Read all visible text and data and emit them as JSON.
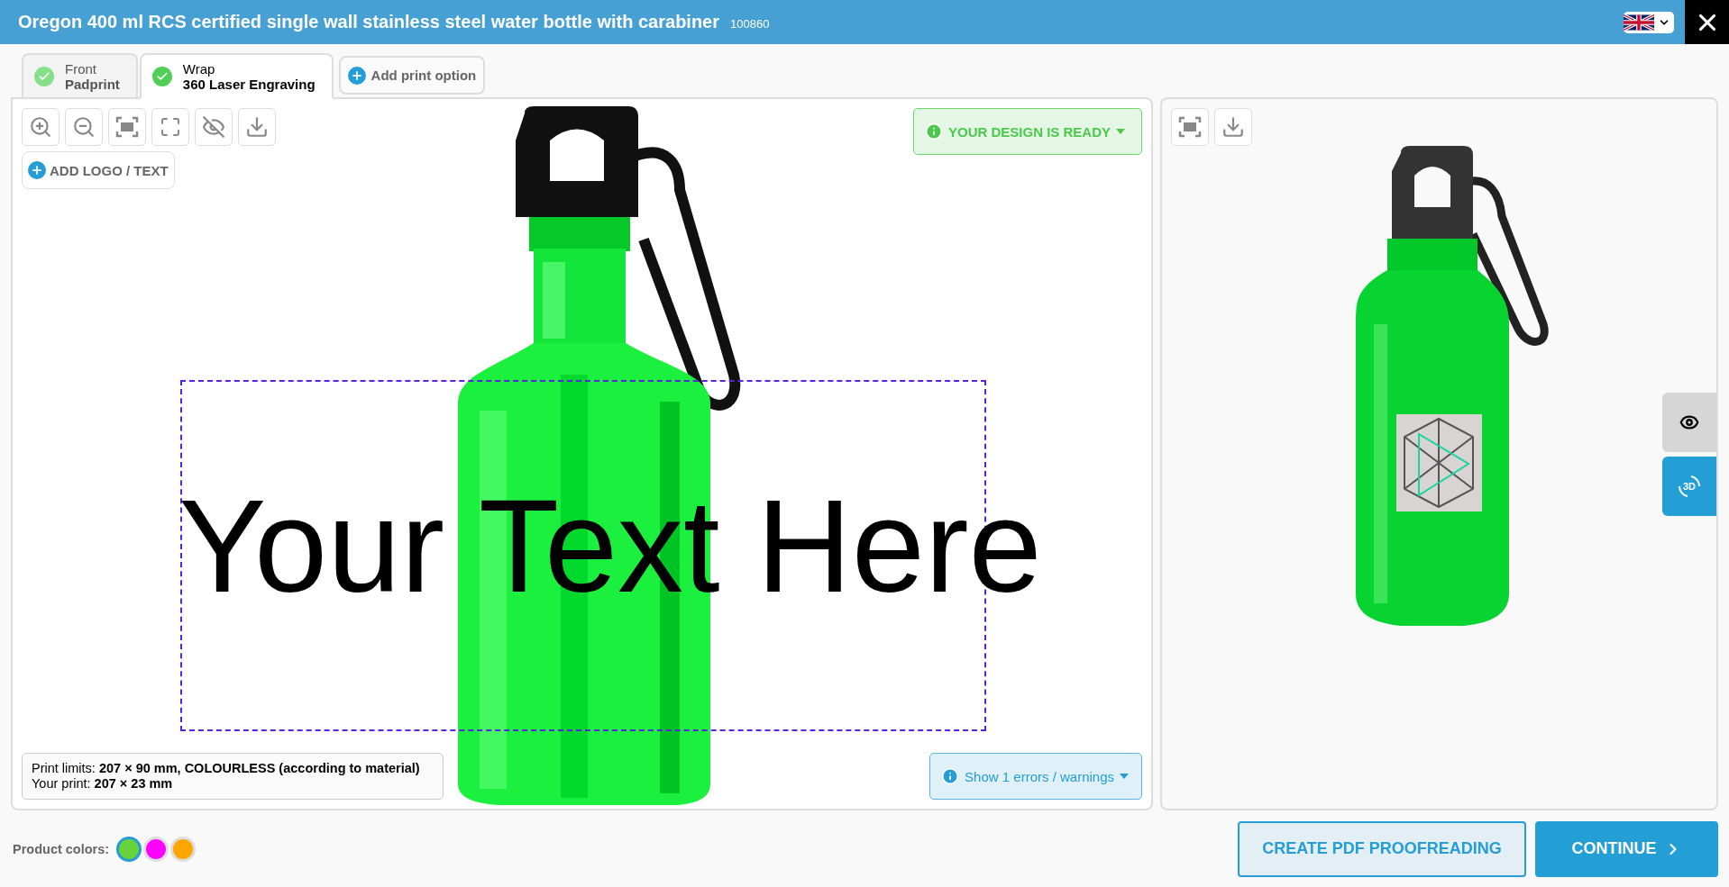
{
  "header": {
    "title": "Oregon 400 ml RCS certified single wall stainless steel water bottle with carabiner",
    "code": "100860"
  },
  "tabs": [
    {
      "title": "Front",
      "subtitle": "Padprint",
      "selected": false
    },
    {
      "title": "Wrap",
      "subtitle": "360 Laser Engraving",
      "selected": true
    }
  ],
  "add_print_option": "Add print option",
  "add_logo": "ADD LOGO / TEXT",
  "status": "YOUR DESIGN IS READY",
  "design_text": "Your Text Here",
  "print_info": [
    "Print limits: **207 × 90 mm, COLOURLESS (according to material)**",
    "Your print: **207 × 23 mm**"
  ],
  "errors_button": "Show 1 errors / warnings",
  "view_3d": "3D",
  "product_colors": {
    "label": "Product colors:",
    "swatches": [
      {
        "color": "#66d43a",
        "selected": true
      },
      {
        "color": "#ff00ff",
        "selected": false
      },
      {
        "color": "#ffa500",
        "selected": false
      }
    ]
  },
  "buttons": [
    {
      "label": "CREATE PDF PROOFREADING",
      "kind": "secondary"
    },
    {
      "label": "CONTINUE",
      "kind": "primary"
    }
  ]
}
